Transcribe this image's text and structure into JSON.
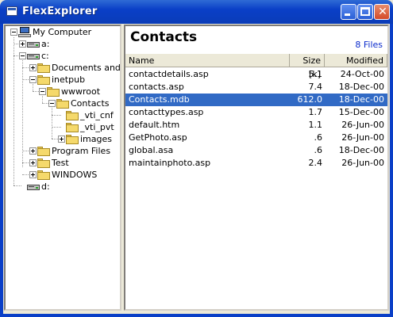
{
  "window": {
    "title": "FlexExplorer"
  },
  "tree": {
    "root": "My Computer",
    "drive_a": "a:",
    "drive_c": "c:",
    "documents": "Documents and ...",
    "inetpub": "inetpub",
    "wwwroot": "wwwroot",
    "contacts": "Contacts",
    "vti_cnf": "_vti_cnf",
    "vti_pvt": "_vti_pvt",
    "images": "images",
    "program_files": "Program Files",
    "test": "Test",
    "windows": "WINDOWS",
    "drive_d": "d:"
  },
  "main": {
    "folder_title": "Contacts",
    "file_count": "8 Files",
    "columns": {
      "name": "Name",
      "size": "Size [k]",
      "modified": "Modified"
    },
    "files": [
      {
        "name": "contactdetails.asp",
        "size": "5.1",
        "modified": "24-Oct-00"
      },
      {
        "name": "contacts.asp",
        "size": "7.4",
        "modified": "18-Dec-00"
      },
      {
        "name": "Contacts.mdb",
        "size": "612.0",
        "modified": "18-Dec-00"
      },
      {
        "name": "contacttypes.asp",
        "size": "1.7",
        "modified": "15-Dec-00"
      },
      {
        "name": "default.htm",
        "size": "1.1",
        "modified": "26-Jun-00"
      },
      {
        "name": "GetPhoto.asp",
        "size": ".6",
        "modified": "26-Jun-00"
      },
      {
        "name": "global.asa",
        "size": ".6",
        "modified": "18-Dec-00"
      },
      {
        "name": "maintainphoto.asp",
        "size": "2.4",
        "modified": "26-Jun-00"
      }
    ],
    "selected_file": "Contacts.mdb"
  },
  "colors": {
    "title_bar": "#0a3fc7",
    "selection": "#316ac5",
    "file_count": "#0a2bcc"
  }
}
